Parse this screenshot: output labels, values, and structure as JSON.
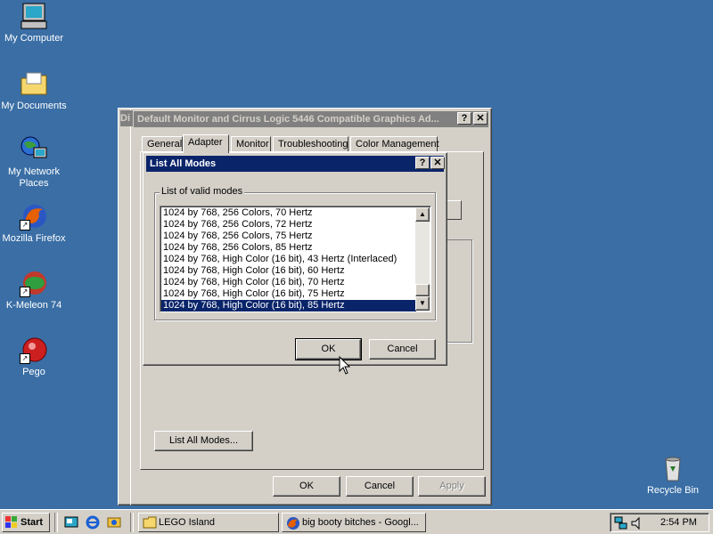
{
  "desktop": {
    "icons": [
      {
        "label": "My Computer"
      },
      {
        "label": "My Documents"
      },
      {
        "label": "My Network Places"
      },
      {
        "label": "Mozilla Firefox"
      },
      {
        "label": "K-Meleon 74"
      },
      {
        "label": "Pego"
      },
      {
        "label": "Recycle Bin"
      }
    ]
  },
  "display_props": {
    "title_prefix": "Di",
    "title": "Default Monitor and Cirrus Logic 5446 Compatible Graphics Ad...",
    "tabs": [
      "General",
      "Adapter",
      "Monitor",
      "Troubleshooting",
      "Color Management"
    ],
    "active_tab": "Adapter",
    "list_all_modes_button": "List All Modes...",
    "ok": "OK",
    "cancel": "Cancel",
    "apply": "Apply"
  },
  "modes_dialog": {
    "title": "List All Modes",
    "group_label": "List of valid modes",
    "modes": [
      "1024 by 768, 256 Colors, 70 Hertz",
      "1024 by 768, 256 Colors, 72 Hertz",
      "1024 by 768, 256 Colors, 75 Hertz",
      "1024 by 768, 256 Colors, 85 Hertz",
      "1024 by 768, High Color (16 bit), 43 Hertz (Interlaced)",
      "1024 by 768, High Color (16 bit), 60 Hertz",
      "1024 by 768, High Color (16 bit), 70 Hertz",
      "1024 by 768, High Color (16 bit), 75 Hertz",
      "1024 by 768, High Color (16 bit), 85 Hertz"
    ],
    "selected_index": 8,
    "ok": "OK",
    "cancel": "Cancel"
  },
  "taskbar": {
    "start": "Start",
    "tasks": [
      "LEGO Island",
      "big booty bitches - Googl..."
    ],
    "clock": "2:54 PM"
  },
  "colors": {
    "desktop": "#3a6ea5",
    "title_active": "#0a246a",
    "title_inactive": "#808080",
    "face": "#d4d0c8"
  }
}
